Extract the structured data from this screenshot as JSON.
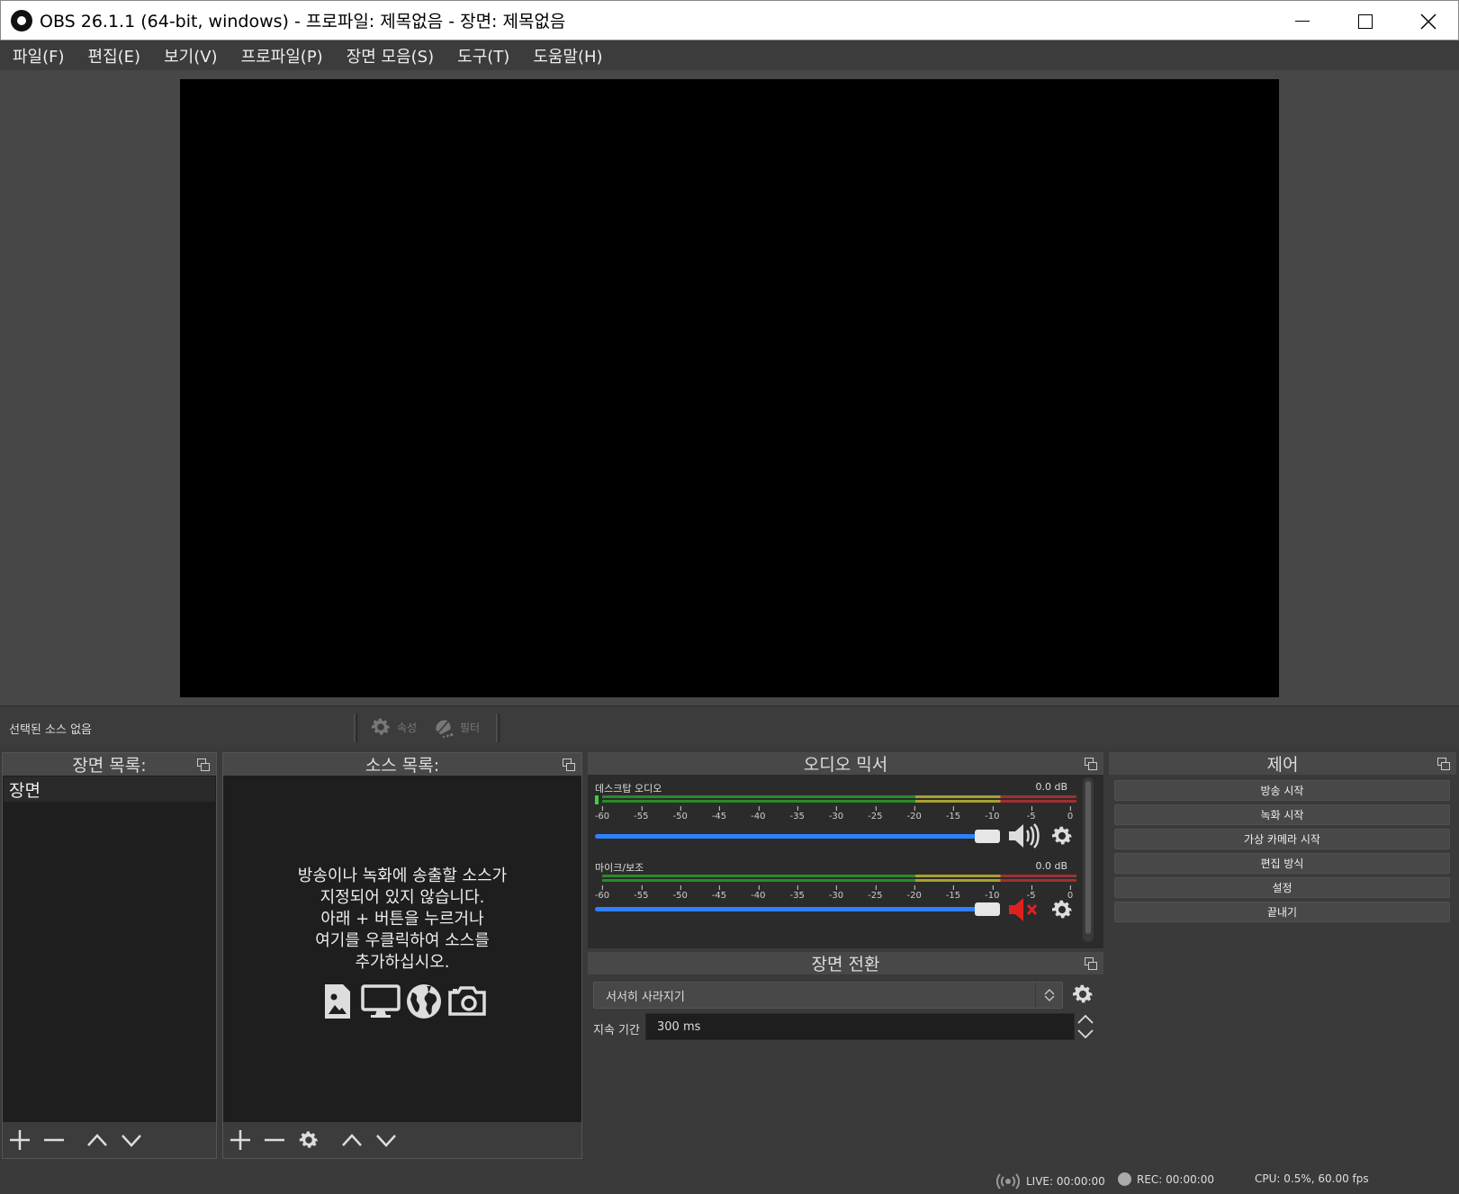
{
  "window": {
    "title": "OBS 26.1.1 (64-bit, windows) - 프로파일: 제목없음 - 장면: 제목없음",
    "controls": [
      "minimize",
      "maximize",
      "close"
    ]
  },
  "menu": [
    "파일(F)",
    "편집(E)",
    "보기(V)",
    "프로파일(P)",
    "장면 모음(S)",
    "도구(T)",
    "도움말(H)"
  ],
  "source_toolbar": {
    "no_selection": "선택된 소스 없음",
    "properties_label": "속성",
    "filters_label": "필터"
  },
  "scenes": {
    "title": "장면 목록:",
    "items": [
      "장면"
    ]
  },
  "sources": {
    "title": "소스 목록:",
    "empty_lines": [
      "방송이나 녹화에 송출할 소스가",
      "지정되어 있지 않습니다.",
      "아래 + 버튼을 누르거나",
      "여기를 우클릭하여 소스를",
      "추가하십시오."
    ]
  },
  "mixer": {
    "title": "오디오 믹서",
    "channels": [
      {
        "name": "데스크탑 오디오",
        "db": "0.0 dB",
        "muted": false,
        "volume": 1.0
      },
      {
        "name": "마이크/보조",
        "db": "0.0 dB",
        "muted": true,
        "volume": 1.0
      }
    ],
    "ticks": [
      "-60",
      "-55",
      "-50",
      "-45",
      "-40",
      "-35",
      "-30",
      "-25",
      "-20",
      "-15",
      "-10",
      "-5",
      "0"
    ]
  },
  "transitions": {
    "title": "장면 전환",
    "selected": "서서히 사라지기",
    "duration_label": "지속 기간",
    "duration_value": "300 ms"
  },
  "controls": {
    "title": "제어",
    "buttons": [
      "방송 시작",
      "녹화 시작",
      "가상 카메라 시작",
      "편집 방식",
      "설정",
      "끝내기"
    ]
  },
  "status": {
    "live": "LIVE: 00:00:00",
    "rec": "REC: 00:00:00",
    "cpu": "CPU: 0.5%, 60.00 fps"
  },
  "colors": {
    "accent_blue": "#2e80ff",
    "muted_red": "#e02020",
    "meter_green": "#2a8a2a",
    "meter_yellow": "#a8a030",
    "meter_red": "#a03030"
  }
}
